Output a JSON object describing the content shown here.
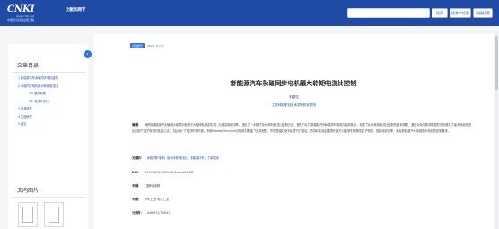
{
  "header": {
    "logo_text": "CNKI",
    "logo_url": "www.cnki.net",
    "logo_subtitle": "中国知识基础设施工程",
    "site_tag": "文献知网节",
    "search_placeholder": "",
    "buttons": [
      "检索",
      "结果中检索",
      "高级检索"
    ]
  },
  "sidebar": {
    "toc_title": "文章目录",
    "toc_items": [
      {
        "label": "1 新能源汽车永磁同步电机结构",
        "sub": false
      },
      {
        "label": "2 永磁同步电机最大转矩电流比",
        "sub": false
      },
      {
        "label": "2.1 基本原理",
        "sub": true
      },
      {
        "label": "2.2 电流环设计",
        "sub": true
      },
      {
        "label": "3 仿真研究",
        "sub": false
      },
      {
        "label": "4 实验研究",
        "sub": false
      },
      {
        "label": "5 结论",
        "sub": false
      }
    ],
    "figures_title": "文内图片",
    "collapse_icon": "‹"
  },
  "article": {
    "badge": "基础研究",
    "date": "2021 33 (7)",
    "title": "新能源汽车永磁同步电机最大转矩电流比控制",
    "author": "蒋建伍",
    "organization": "江苏科技职业技术学院机电学院",
    "abstract_label": "摘要：",
    "abstract": "考虑到新能源汽车使用永磁同步电机作为驱动电机的情况，为提高电机效率，提出了一种基于最大转矩电流比控制方法，首先介绍了新能源汽车永磁同步电机的结构特点，阐述了最大转矩电流比控制的基本原理，通过对电机数学模型的分析推导了最大转矩电流比控制下定子电流的给定方法，然后设计了电流环调节器，利用Matlab/Simulink仿真软件搭建了仿真模型，同时搭建实验平台进行了验证，仿真和实验结果表明该方法能够有效降低定子电流，提高电机效率，满足新能源汽车永磁同步电机的控制要求。",
    "keywords_label": "关键词：",
    "keywords": "永磁同步电机；最大转矩电流比；新能源汽车；矢量控制",
    "doi_label": "DOI：",
    "doi": "10.19457/j.1001-2095.dqcd21403",
    "class_label": "专辑：",
    "class_value": "工程科技Ⅱ辑",
    "pub_label": "专题：",
    "pub_value": "汽车工业; 电力工业",
    "pages_label": "分类号：",
    "pages_value": "U469.72;TM341"
  }
}
